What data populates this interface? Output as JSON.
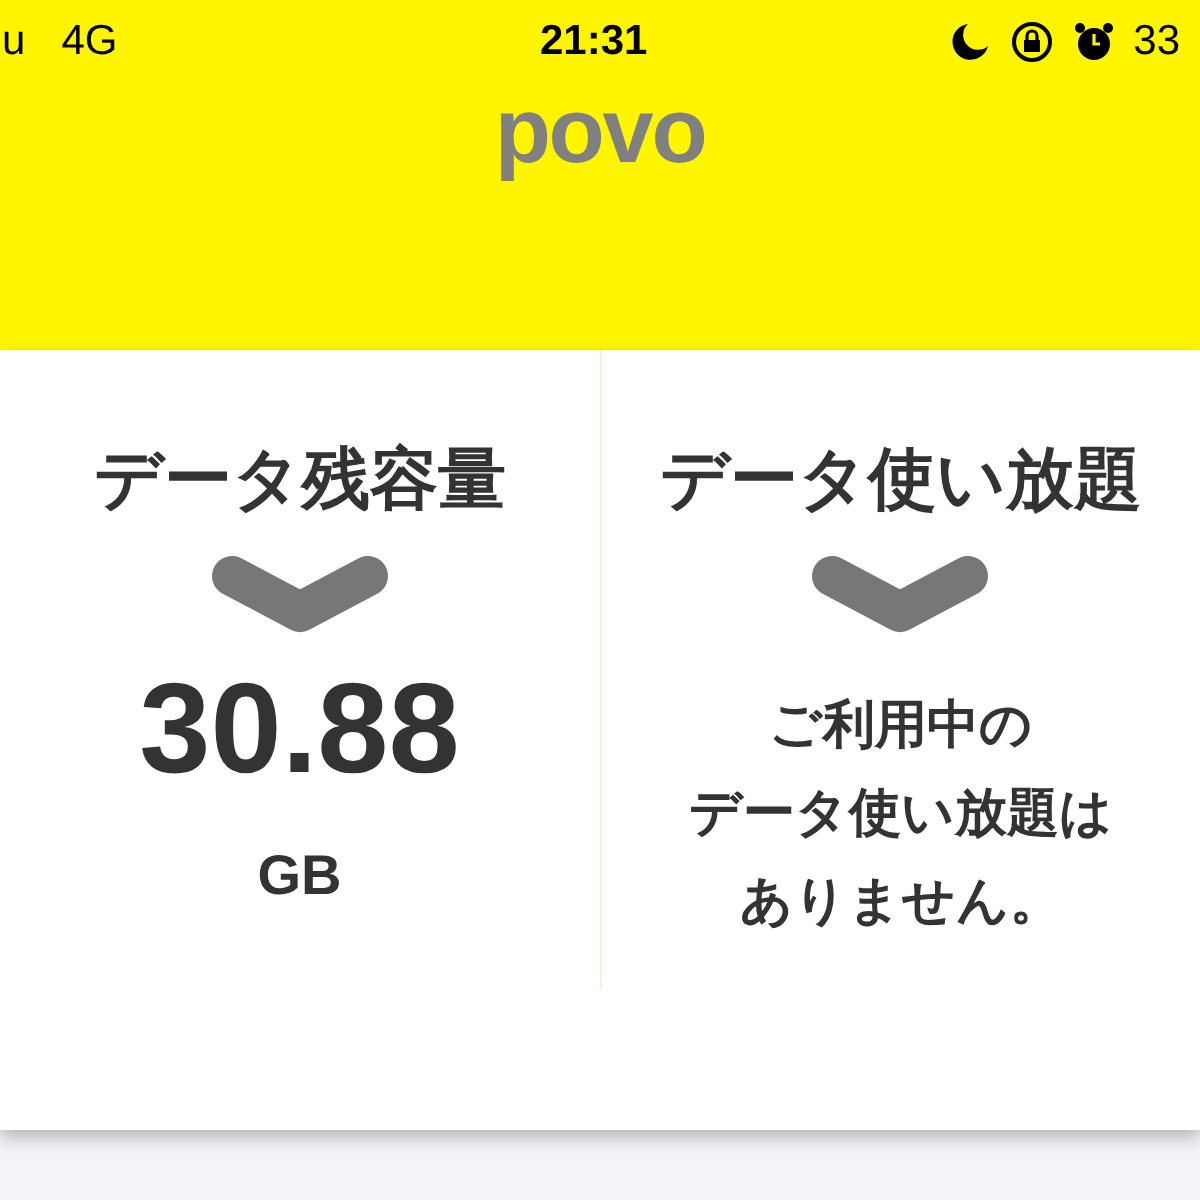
{
  "status_bar": {
    "carrier": "u",
    "network": "4G",
    "time": "21:31",
    "battery": "33"
  },
  "header": {
    "logo": "povo"
  },
  "panels": [
    {
      "title": "データ残容量",
      "kind": "amount",
      "value": "30.88",
      "unit": "GB"
    },
    {
      "title": "データ使い放題",
      "kind": "message",
      "lines": [
        "ご利用中の",
        "データ使い放題は",
        "ありません。"
      ]
    }
  ]
}
